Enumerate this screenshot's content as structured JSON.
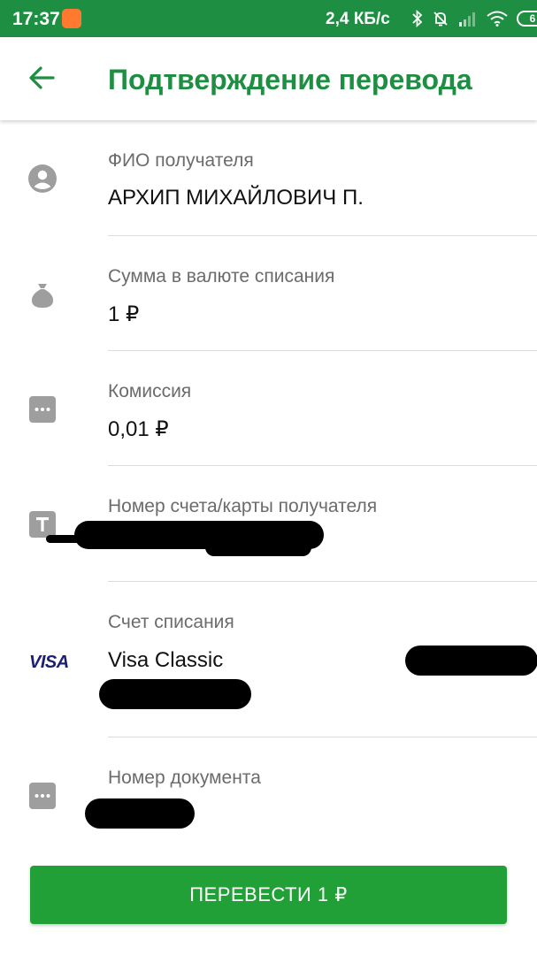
{
  "status_bar": {
    "time": "17:37",
    "network_speed": "2,4 КБ/с",
    "battery_level": "6",
    "icons": [
      "app-notification-icon",
      "bluetooth-icon",
      "mute-icon",
      "signal-icon",
      "wifi-icon",
      "battery-icon"
    ]
  },
  "header": {
    "title": "Подтверждение перевода",
    "back_icon": "arrow-back-icon"
  },
  "details": {
    "recipient": {
      "label": "ФИО получателя",
      "value": "АРХИП МИХАЙЛОВИЧ П.",
      "icon": "person-icon"
    },
    "amount": {
      "label": "Сумма в валюте списания",
      "value": "1 ₽",
      "icon": "money-bag-icon"
    },
    "commission": {
      "label": "Комиссия",
      "value": "0,01 ₽",
      "icon": "more-icon"
    },
    "account_number": {
      "label": "Номер счета/карты получателя",
      "icon": "text-t-icon"
    },
    "debit_account": {
      "label": "Счет списания",
      "value": "Visa Classic",
      "icon": "visa-logo",
      "logo_text": "VISA"
    },
    "document_number": {
      "label": "Номер документа",
      "icon": "more-icon"
    }
  },
  "action": {
    "button_label": "ПЕРЕВЕСТИ 1 ₽"
  },
  "colors": {
    "brand_green": "#1e8f42",
    "button_green": "#21a038",
    "icon_gray": "#9e9e9e",
    "visa_blue": "#1a1f71"
  }
}
